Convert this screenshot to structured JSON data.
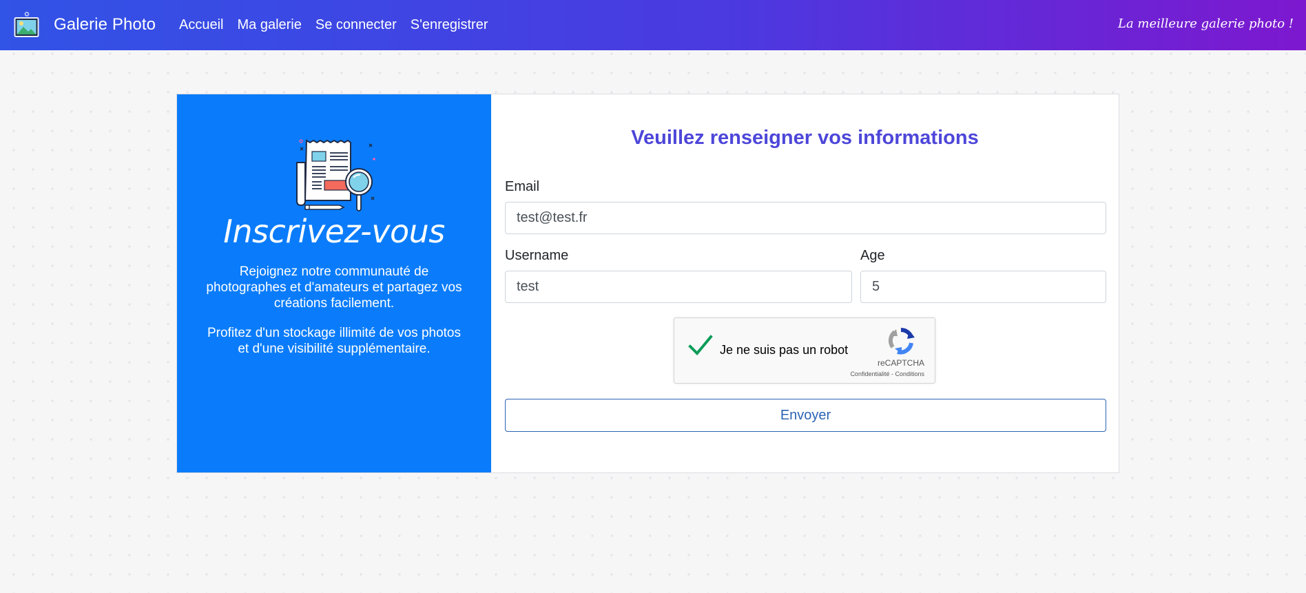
{
  "navbar": {
    "brand": "Galerie Photo",
    "links": [
      "Accueil",
      "Ma galerie",
      "Se connecter",
      "S'enregistrer"
    ],
    "slogan": "La meilleure galerie photo !",
    "gradient_start": "#3153e6",
    "gradient_end": "#7d18cf"
  },
  "left_panel": {
    "title": "Inscrivez-vous",
    "paragraph1": "Rejoignez notre communauté de photographes et d'amateurs et partagez vos créations facilement.",
    "paragraph2": "Profitez d'un stockage illimité de vos photos et d'une visibilité supplémentaire.",
    "background_color": "#0a7cfb",
    "illustration_icon": "newspaper-magnifier-icon"
  },
  "form": {
    "title": "Veuillez renseigner vos informations",
    "email_label": "Email",
    "email_value": "test@test.fr",
    "username_label": "Username",
    "username_value": "test",
    "age_label": "Age",
    "age_value": "5",
    "submit_label": "Envoyer"
  },
  "captcha": {
    "label": "Je ne suis pas un robot",
    "brand": "reCAPTCHA",
    "links": "Confidentialité - Conditions",
    "checked": true
  }
}
